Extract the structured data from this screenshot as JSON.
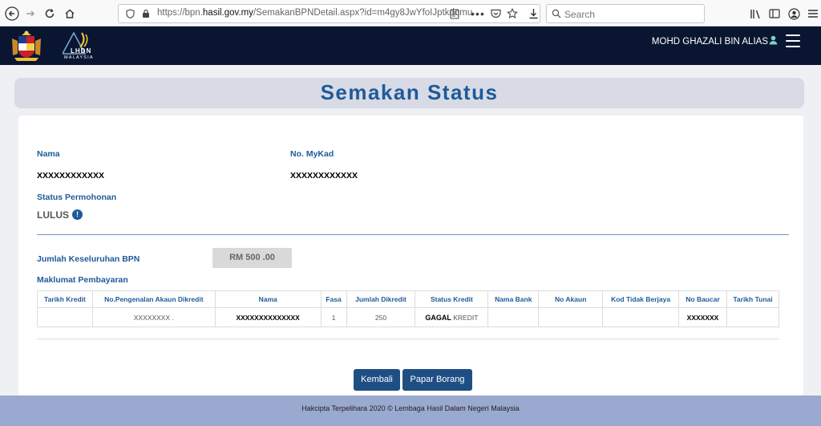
{
  "browser": {
    "url_prefix": "https://bpn.",
    "url_domain": "hasil.gov.my",
    "url_suffix": "/SemakanBPNDetail.aspx?id=m4gy8JwYfoIJptkdomu",
    "search_placeholder": "Search"
  },
  "header": {
    "user_name": "MOHD GHAZALI BIN ALIAS",
    "logo_text": "LHDN",
    "logo_subtext": "MALAYSIA"
  },
  "page": {
    "title": "Semakan Status"
  },
  "details": {
    "nama_label": "Nama",
    "nama_value": "XXXXXXXXXXXX",
    "mykad_label": "No. MyKad",
    "mykad_value": "XXXXXXXXXXXX",
    "status_label": "Status Permohonan",
    "status_value": "LULUS",
    "status_info": "!",
    "jumlah_label": "Jumlah Keseluruhan BPN",
    "jumlah_value": "RM 500 .00",
    "maklumat_label": "Maklumat Pembayaran"
  },
  "table": {
    "headers": [
      "Tarikh Kredit",
      "No.Pengenalan Akaun Dikredit",
      "Nama",
      "Fasa",
      "Jumlah Dikredit",
      "Status Kredit",
      "Nama Bank",
      "No Akaun",
      "Kod Tidak Berjaya",
      "No Baucar",
      "Tarikh Tunai"
    ],
    "row": {
      "tarikh_kredit": "",
      "akaun": "XXXXXXXX .",
      "nama": "XXXXXXXXXXXXXX",
      "fasa": "1",
      "jumlah": "250",
      "status_bold": "GAGAL",
      "status_rest": " KREDIT",
      "nama_bank": "",
      "no_akaun": "",
      "kod": "",
      "baucar": "XXXXXXX",
      "tarikh_tunai": ""
    }
  },
  "buttons": {
    "kembali": "Kembali",
    "papar": "Papar Borang"
  },
  "footer": {
    "text": "Hakcipta Terpelihara 2020 © Lembaga Hasil Dalam Negeri Malaysia"
  }
}
